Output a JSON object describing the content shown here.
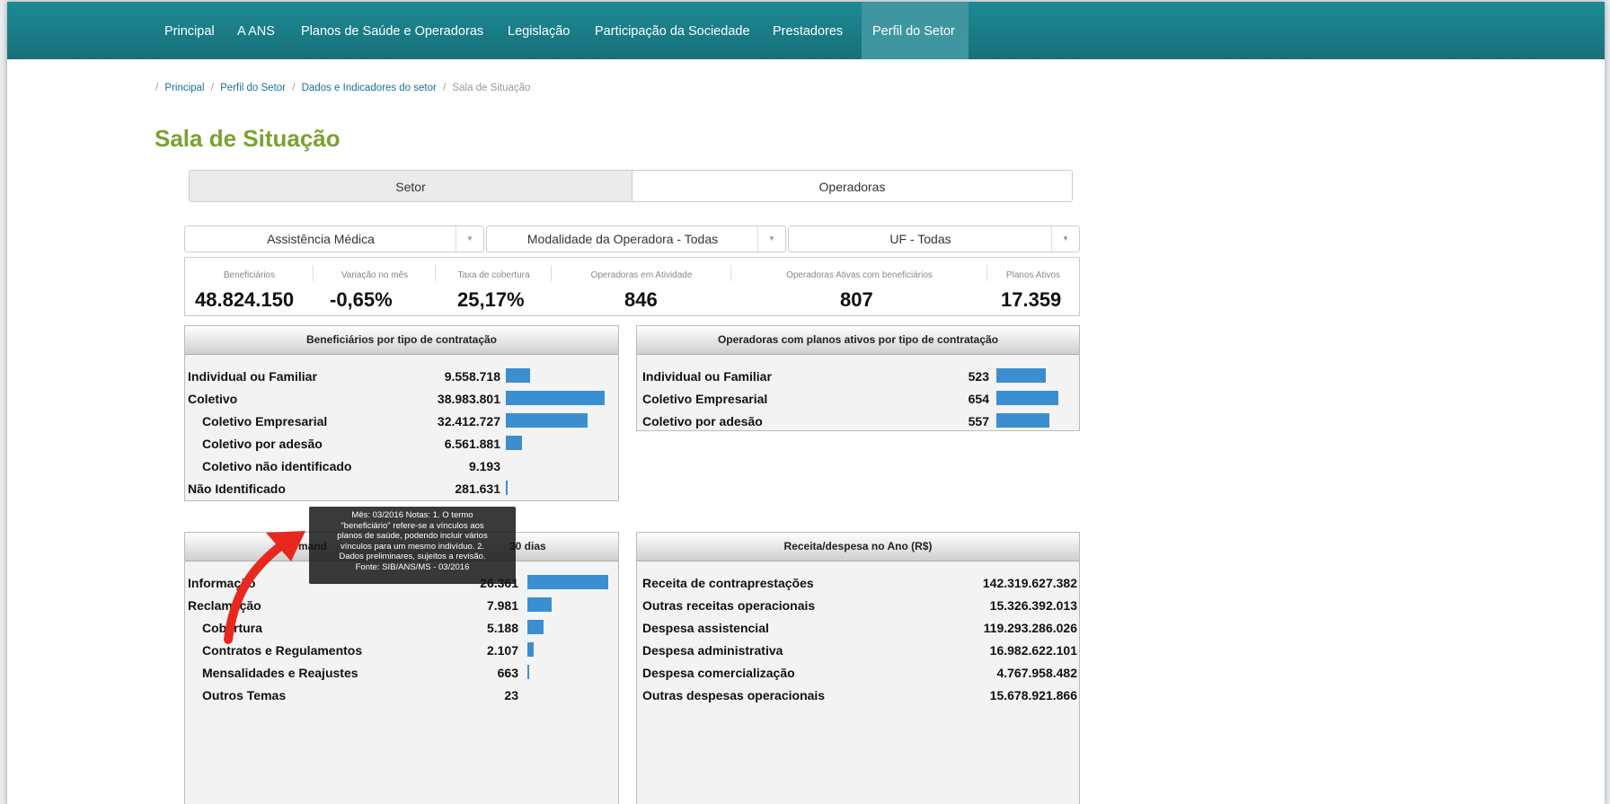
{
  "nav": {
    "items": [
      {
        "label": "Principal"
      },
      {
        "label": "A ANS"
      },
      {
        "label": "Planos de Saúde e Operadoras"
      },
      {
        "label": "Legislação"
      },
      {
        "label": "Participação da Sociedade"
      },
      {
        "label": "Prestadores"
      },
      {
        "label": "Perfil do Setor",
        "active": true
      }
    ]
  },
  "breadcrumb": {
    "separator": "/",
    "items": [
      "Principal",
      "Perfil do Setor",
      "Dados e Indicadores do setor",
      "Sala de Situação"
    ]
  },
  "page_title": "Sala de Situação",
  "tabs": [
    {
      "label": "Setor",
      "active": true
    },
    {
      "label": "Operadoras",
      "active": false
    }
  ],
  "filters": [
    {
      "value": "Assistência Médica"
    },
    {
      "value": "Modalidade da Operadora - Todas"
    },
    {
      "value": "UF - Todas"
    }
  ],
  "stats": [
    {
      "label": "Beneficiários",
      "value": "48.824.150"
    },
    {
      "label": "Variação no mês",
      "value": "-0,65%"
    },
    {
      "label": "Taxa de cobertura",
      "value": "25,17%"
    },
    {
      "label": "Operadoras em Atividade",
      "value": "846"
    },
    {
      "label": "Operadoras Ativas com beneficiários",
      "value": "807"
    },
    {
      "label": "Planos Ativos",
      "value": "17.359"
    }
  ],
  "panel_beneficiarios": {
    "title": "Beneficiários por tipo de contratação",
    "rows": [
      {
        "label": "Individual ou Familiar",
        "value": "9.558.718",
        "bar": 0.245
      },
      {
        "label": "Coletivo",
        "value": "38.983.801",
        "bar": 1.0
      },
      {
        "label": "Coletivo Empresarial",
        "value": "32.412.727",
        "bar": 0.831
      },
      {
        "label": "Coletivo por adesão",
        "value": "6.561.881",
        "bar": 0.168
      },
      {
        "label": "Coletivo não identificado",
        "value": "9.193",
        "bar": 0
      },
      {
        "label": "Não Identificado",
        "value": "281.631",
        "bar": 0.007
      }
    ]
  },
  "panel_operadoras": {
    "title": "Operadoras com planos ativos por tipo de contratação",
    "rows": [
      {
        "label": "Individual ou Familiar",
        "value": "523",
        "bar": 0.8
      },
      {
        "label": "Coletivo Empresarial",
        "value": "654",
        "bar": 1.0
      },
      {
        "label": "Coletivo por adesão",
        "value": "557",
        "bar": 0.852
      }
    ]
  },
  "panel_demandas": {
    "title_left": "mand",
    "title_right": "30 dias",
    "rows": [
      {
        "label": "Informação",
        "value": "26.361",
        "bar": 1.0
      },
      {
        "label": "Reclamação",
        "value": "7.981",
        "bar": 0.303
      },
      {
        "label": "Cobertura",
        "value": "5.188",
        "bar": 0.197
      },
      {
        "label": "Contratos e Regulamentos",
        "value": "2.107",
        "bar": 0.08
      },
      {
        "label": "Mensalidades e Reajustes",
        "value": "663",
        "bar": 0.025
      },
      {
        "label": "Outros Temas",
        "value": "23",
        "bar": 0
      }
    ]
  },
  "panel_receita": {
    "title": "Receita/despesa no Ano (R$)",
    "rows": [
      {
        "label": "Receita de contraprestações",
        "value": "142.319.627.382"
      },
      {
        "label": "Outras receitas operacionais",
        "value": "15.326.392.013"
      },
      {
        "label": "Despesa assistencial",
        "value": "119.293.286.026"
      },
      {
        "label": "Despesa administrativa",
        "value": "16.982.622.101"
      },
      {
        "label": "Despesa comercialização",
        "value": "4.767.958.482"
      },
      {
        "label": "Outras despesas operacionais",
        "value": "15.678.921.866"
      }
    ]
  },
  "tooltip": {
    "lines": [
      "Mês: 03/2016 Notas: 1. O termo",
      "\"beneficiário\" refere-se a vínculos aos",
      "planos de saúde, podendo incluir vários",
      "vínculos para um mesmo indivíduo. 2.",
      "Dados preliminares, sujeitos a revisão.",
      "Fonte: SIB/ANS/MS - 03/2016"
    ]
  },
  "colors": {
    "nav_bg": "#1d8a94",
    "title": "#7aa232",
    "bar": "#3b8fd1",
    "arrow": "#e8271f"
  }
}
